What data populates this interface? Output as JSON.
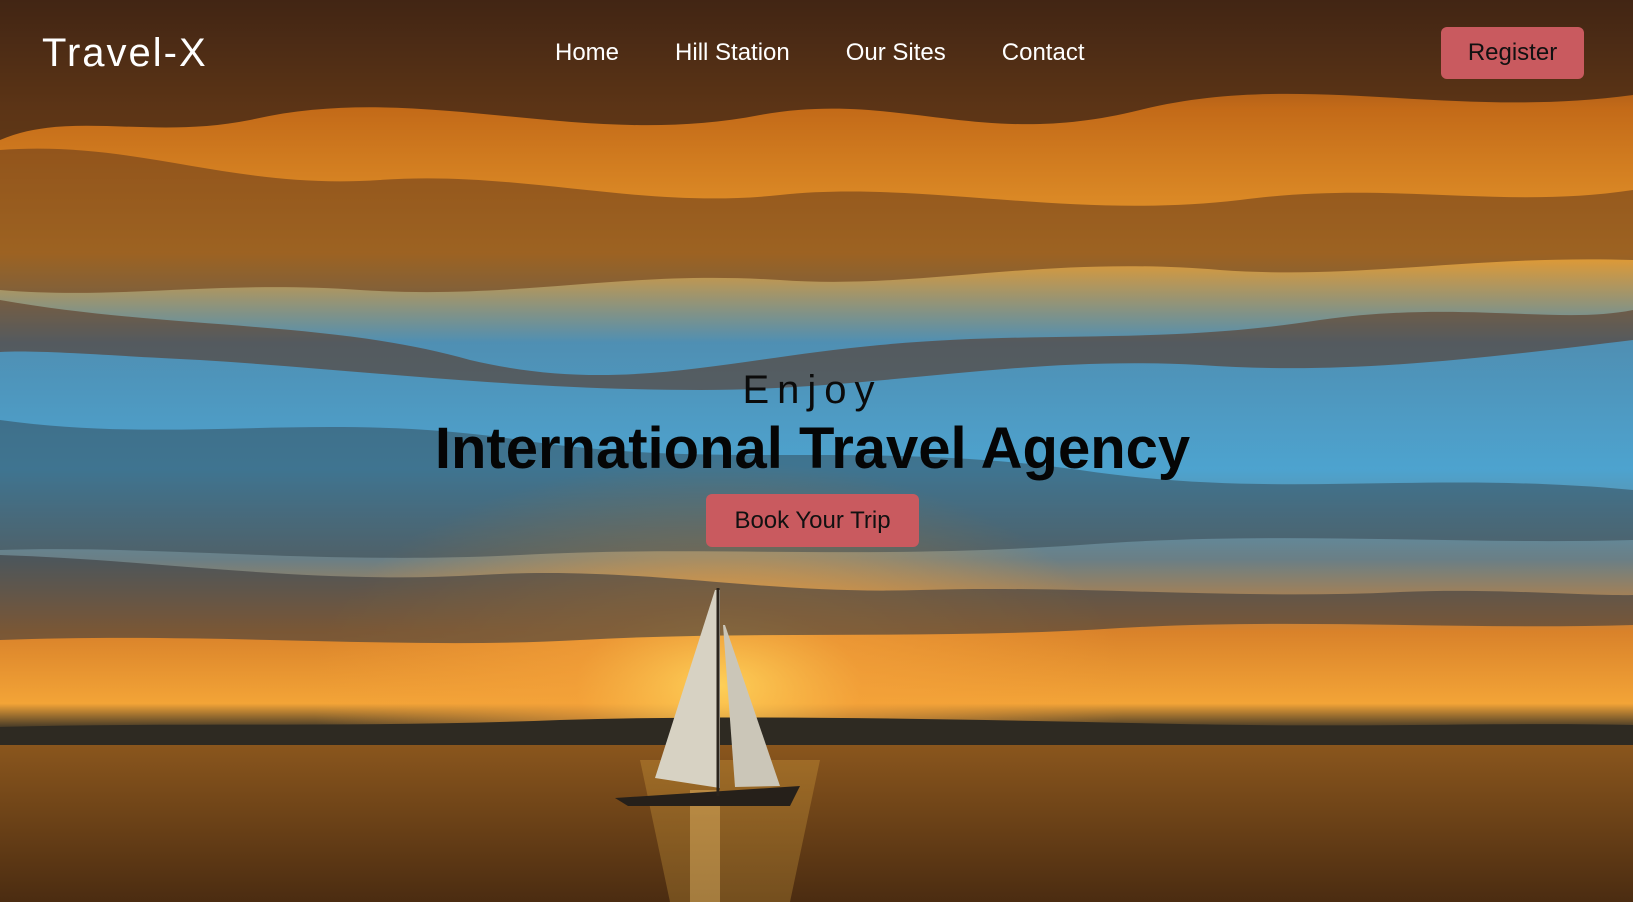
{
  "brand": {
    "logo_text": "Travel-X"
  },
  "nav": {
    "items": [
      {
        "label": "Home"
      },
      {
        "label": "Hill Station"
      },
      {
        "label": "Our Sites"
      },
      {
        "label": "Contact"
      }
    ]
  },
  "header": {
    "register_label": "Register"
  },
  "hero": {
    "kicker": "Enjoy",
    "headline": "International Travel Agency",
    "cta_label": "Book Your Trip",
    "background_icon": "sunset-sailboat-image"
  },
  "colors": {
    "accent": "#c95a5f",
    "nav_text": "#ffffff",
    "headline_text": "#050505"
  }
}
